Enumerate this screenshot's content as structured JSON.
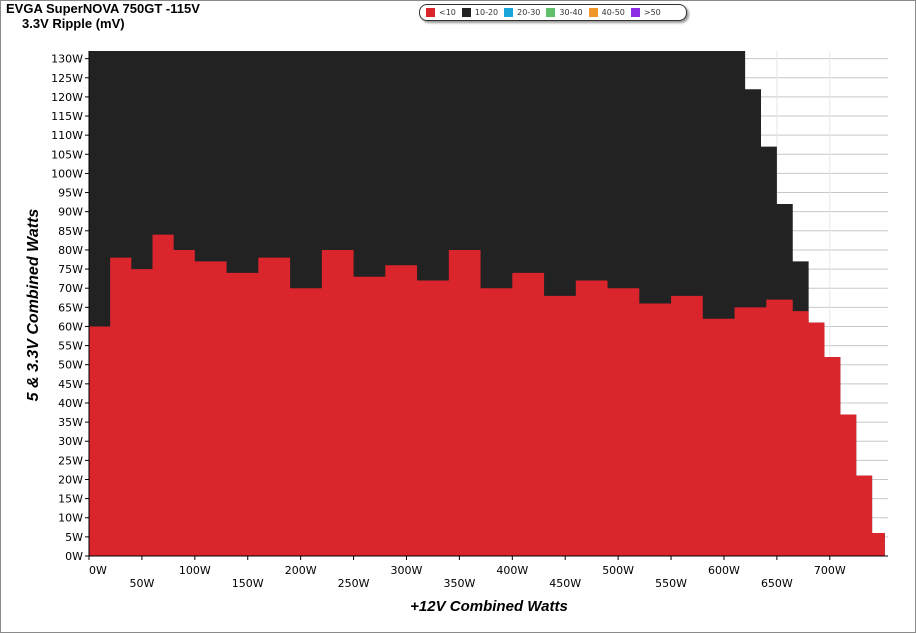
{
  "header": {
    "title": "EVGA SuperNOVA 750GT -115V",
    "subtitle": "3.3V Ripple (mV)"
  },
  "legend": [
    {
      "label": "<10",
      "color": "#d9252b"
    },
    {
      "label": "10-20",
      "color": "#222222"
    },
    {
      "label": "20-30",
      "color": "#1aa6d8"
    },
    {
      "label": "30-40",
      "color": "#5fbf6b"
    },
    {
      "label": "40-50",
      "color": "#f0962b"
    },
    {
      "label": ">50",
      "color": "#8b2be2"
    }
  ],
  "chart_data": {
    "type": "heatmap",
    "xlabel": "+12V Combined Watts",
    "ylabel": "5 & 3.3V Combined Watts",
    "xlim": [
      0,
      750
    ],
    "ylim": [
      0,
      130
    ],
    "x_ticks": [
      "0W",
      "50W",
      "100W",
      "150W",
      "200W",
      "250W",
      "300W",
      "350W",
      "400W",
      "450W",
      "500W",
      "550W",
      "600W",
      "650W",
      "700W"
    ],
    "y_ticks": [
      "0W",
      "5W",
      "10W",
      "15W",
      "20W",
      "25W",
      "30W",
      "35W",
      "40W",
      "45W",
      "50W",
      "55W",
      "60W",
      "65W",
      "70W",
      "75W",
      "80W",
      "85W",
      "90W",
      "95W",
      "100W",
      "105W",
      "110W",
      "115W",
      "120W",
      "125W",
      "130W"
    ],
    "grid": true,
    "max_load_envelope": [
      {
        "x": 0,
        "y_max": 132
      },
      {
        "x": 620,
        "y_max": 132
      },
      {
        "x": 620,
        "y_max": 122
      },
      {
        "x": 635,
        "y_max": 122
      },
      {
        "x": 635,
        "y_max": 107
      },
      {
        "x": 650,
        "y_max": 107
      },
      {
        "x": 650,
        "y_max": 92
      },
      {
        "x": 665,
        "y_max": 92
      },
      {
        "x": 665,
        "y_max": 77
      },
      {
        "x": 680,
        "y_max": 77
      },
      {
        "x": 680,
        "y_max": 61
      },
      {
        "x": 695,
        "y_max": 61
      },
      {
        "x": 695,
        "y_max": 52
      },
      {
        "x": 710,
        "y_max": 52
      },
      {
        "x": 710,
        "y_max": 37
      },
      {
        "x": 725,
        "y_max": 37
      },
      {
        "x": 725,
        "y_max": 21
      },
      {
        "x": 740,
        "y_max": 21
      },
      {
        "x": 740,
        "y_max": 6
      },
      {
        "x": 752,
        "y_max": 6
      }
    ],
    "band_boundary_lt10_to_10_20": [
      {
        "x": 0,
        "y": 60
      },
      {
        "x": 20,
        "y": 78
      },
      {
        "x": 40,
        "y": 75
      },
      {
        "x": 60,
        "y": 84
      },
      {
        "x": 80,
        "y": 80
      },
      {
        "x": 100,
        "y": 77
      },
      {
        "x": 130,
        "y": 74
      },
      {
        "x": 160,
        "y": 78
      },
      {
        "x": 190,
        "y": 70
      },
      {
        "x": 220,
        "y": 80
      },
      {
        "x": 250,
        "y": 73
      },
      {
        "x": 280,
        "y": 76
      },
      {
        "x": 310,
        "y": 72
      },
      {
        "x": 340,
        "y": 80
      },
      {
        "x": 370,
        "y": 70
      },
      {
        "x": 400,
        "y": 74
      },
      {
        "x": 430,
        "y": 68
      },
      {
        "x": 460,
        "y": 72
      },
      {
        "x": 490,
        "y": 70
      },
      {
        "x": 520,
        "y": 66
      },
      {
        "x": 550,
        "y": 68
      },
      {
        "x": 580,
        "y": 62
      },
      {
        "x": 610,
        "y": 65
      },
      {
        "x": 640,
        "y": 67
      },
      {
        "x": 665,
        "y": 64
      },
      {
        "x": 680,
        "y": 62
      }
    ]
  }
}
